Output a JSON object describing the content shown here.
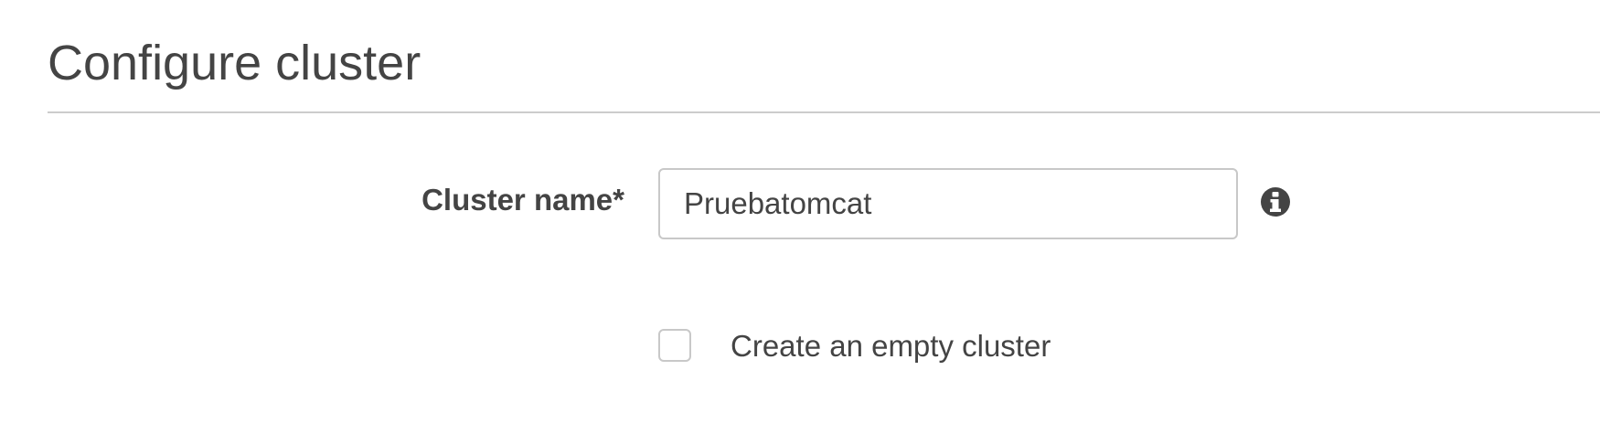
{
  "page": {
    "title": "Configure cluster"
  },
  "form": {
    "cluster_name_label": "Cluster name*",
    "cluster_name_value": "Pruebatomcat",
    "info_icon": "info-icon",
    "empty_cluster_label": "Create an empty cluster",
    "empty_cluster_checked": false
  },
  "colors": {
    "text": "#444444",
    "border": "#c8c8c8",
    "divider": "#cccccc",
    "icon": "#444444"
  }
}
